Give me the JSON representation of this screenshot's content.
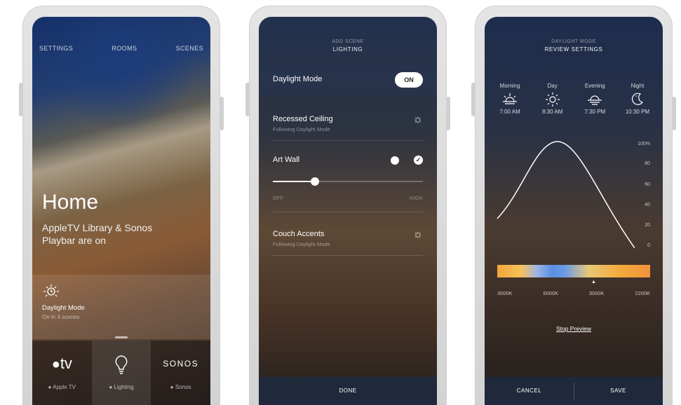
{
  "screen1": {
    "nav": [
      "SETTINGS",
      "ROOMS",
      "SCENES"
    ],
    "title": "Home",
    "subtitle": "AppleTV Library & Sonos Playbar are on",
    "mode_tile": {
      "icon": "clock-sun-icon",
      "label": "Daylight Mode",
      "sublabel": "On in 4 scenes"
    },
    "dock": [
      {
        "icon": "apple-tv-icon",
        "icon_text": "tv",
        "label": "● Apple TV"
      },
      {
        "icon": "lightbulb-icon",
        "icon_text": "",
        "label": "● Lighting"
      },
      {
        "icon": "sonos-logo",
        "icon_text": "SONOS",
        "label": "● Sonos"
      }
    ]
  },
  "screen2": {
    "header_small": "ADD SCENE",
    "header_main": "LIGHTING",
    "daylight": {
      "label": "Daylight Mode",
      "toggle": "ON"
    },
    "recessed": {
      "label": "Recessed Ceiling",
      "sub": "Following Daylight Mode"
    },
    "artwall": {
      "label": "Art Wall",
      "slider_level": 0.28,
      "min_label": "OFF",
      "max_label": "HIGH"
    },
    "couch": {
      "label": "Couch Accents",
      "sub": "Following Daylight Mode"
    },
    "done": "DONE"
  },
  "screen3": {
    "header_small": "DAYLIGHT MODE",
    "header_main": "REVIEW SETTINGS",
    "times": [
      {
        "name": "Morning",
        "icon": "sunrise-icon",
        "time": "7:00 AM"
      },
      {
        "name": "Day",
        "icon": "sun-icon",
        "time": "8:30 AM"
      },
      {
        "name": "Evening",
        "icon": "sunset-icon",
        "time": "7:30 PM"
      },
      {
        "name": "Night",
        "icon": "moon-icon",
        "time": "10:30 PM"
      }
    ],
    "y_labels": [
      "100%",
      "80",
      "60",
      "40",
      "20",
      "0"
    ],
    "kelvin": [
      "3000K",
      "6000K",
      "3000K",
      "2200K"
    ],
    "stop_preview": "Stop Preview",
    "cancel": "CANCEL",
    "save": "SAVE"
  }
}
